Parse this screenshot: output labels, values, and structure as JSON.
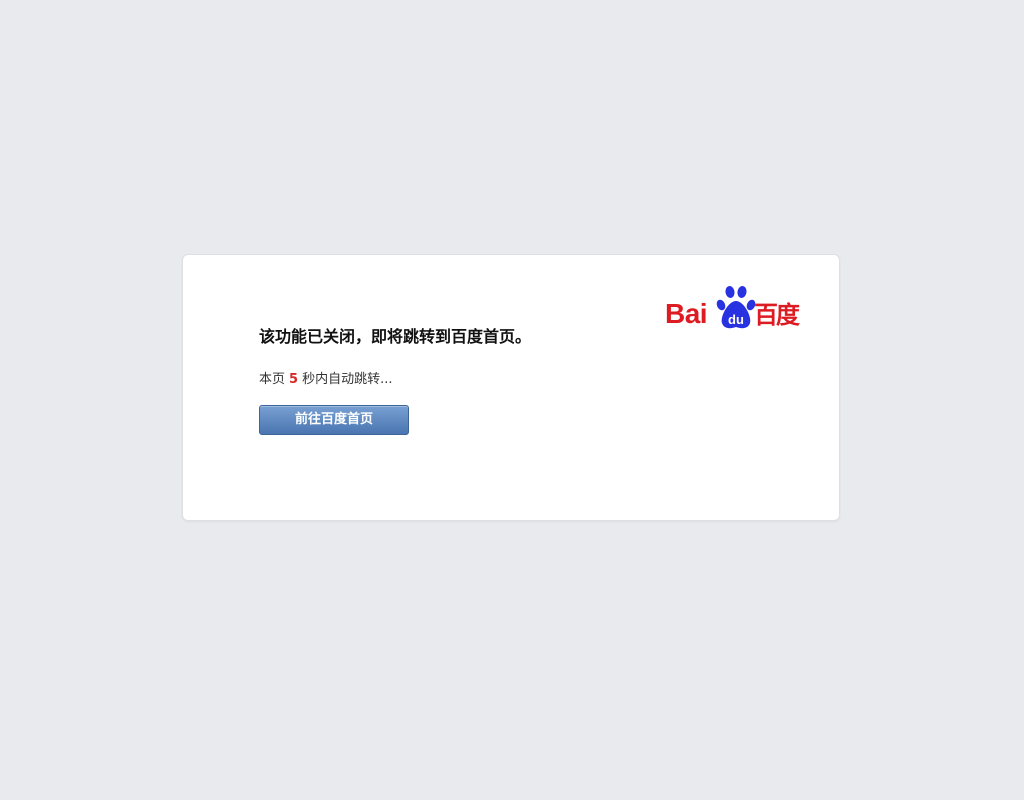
{
  "message": {
    "title": "该功能已关闭，即将跳转到百度首页。",
    "countdown_prefix": "本页",
    "countdown_seconds": "5",
    "countdown_suffix": "秒内自动跳转..."
  },
  "actions": {
    "home_button_label": "前往百度首页"
  },
  "logo": {
    "latin": "Bai",
    "du": "du",
    "chinese": "百度",
    "icon": "baidu-paw-icon",
    "red": "#dd1b22",
    "blue": "#2932e1"
  },
  "colors": {
    "background": "#e8eaee",
    "card": "#ffffff",
    "button_top": "#78a0d3",
    "button_bottom": "#4a75b0",
    "countdown_number": "#d62a2a"
  }
}
